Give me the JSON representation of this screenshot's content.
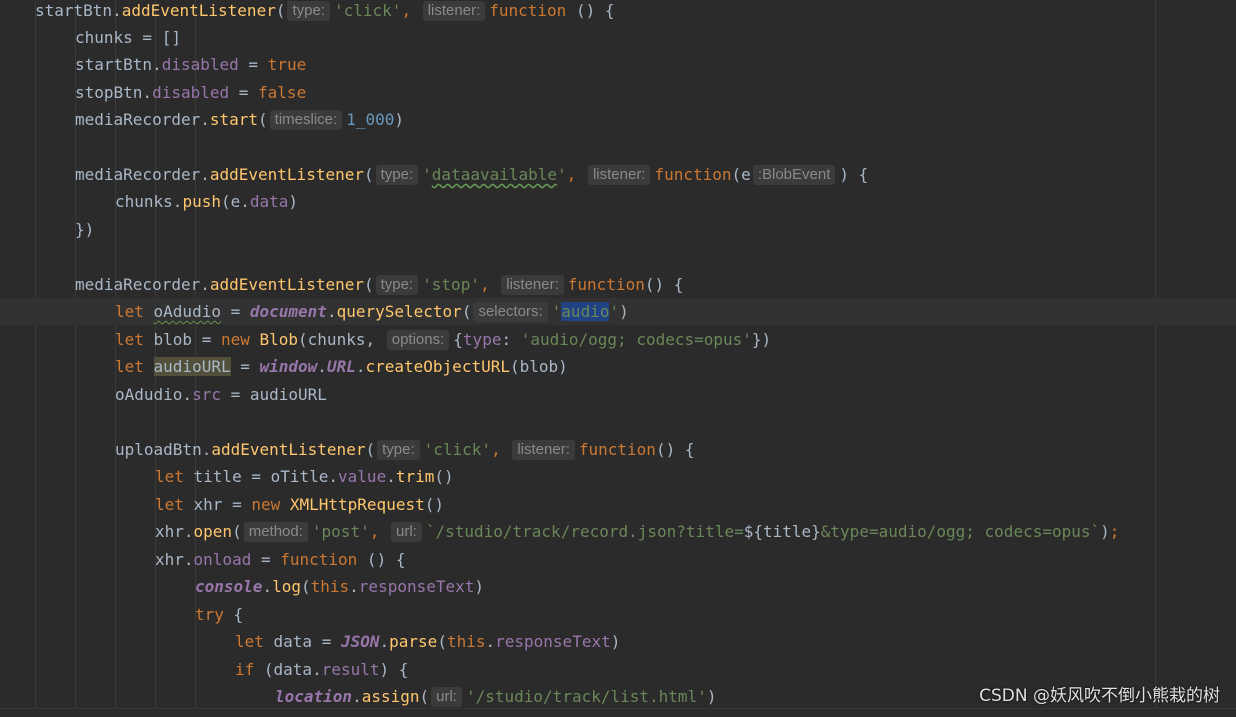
{
  "watermark": "CSDN @妖风吹不倒小熊栽的树",
  "code": {
    "l1": {
      "a": "startBtn.",
      "fn": "addEventListener",
      "b": "(",
      "h1": "type:",
      "s1": "'click'",
      "c": ",",
      "h2": "listener:",
      "kw": "function",
      "d": " () {"
    },
    "l2": {
      "a": "chunks = []"
    },
    "l3": {
      "a": "startBtn.",
      "p": "disabled",
      "b": " = ",
      "kw": "true"
    },
    "l4": {
      "a": "stopBtn.",
      "p": "disabled",
      "b": " = ",
      "kw": "false"
    },
    "l5": {
      "a": "mediaRecorder.",
      "fn": "start",
      "b": "(",
      "h": "timeslice:",
      "n": "1_000",
      "c": ")"
    },
    "l7": {
      "a": "mediaRecorder.",
      "fn": "addEventListener",
      "b": "(",
      "h1": "type:",
      "q1": "'",
      "s": "dataavailable",
      "q2": "'",
      "c": ",",
      "h2": "listener:",
      "kw": "function",
      "d": "(e",
      "h3": ":BlobEvent",
      "e": ") {"
    },
    "l8": {
      "a": "chunks.",
      "fn": "push",
      "b": "(e.",
      "p": "data",
      "c": ")"
    },
    "l9": {
      "a": "})"
    },
    "l11": {
      "a": "mediaRecorder.",
      "fn": "addEventListener",
      "b": "(",
      "h1": "type:",
      "s": "'stop'",
      "c": ",",
      "h2": "listener:",
      "kw": "function",
      "d": "() {"
    },
    "l12": {
      "kw": "let ",
      "v": "oAdudio",
      "b": " = ",
      "g": "document",
      "c": ".",
      "fn": "querySelector",
      "d": "(",
      "h": "selectors:",
      "q1": "'",
      "sel": "audio",
      "q2": "'",
      "e": ")"
    },
    "l13": {
      "kw": "let ",
      "a": "blob = ",
      "kw2": "new ",
      "fn": "Blob",
      "b": "(chunks,",
      "h": "options:",
      "c": "{",
      "p": "type",
      "d": ": ",
      "s": "'audio/ogg; codecs=opus'",
      "e": "})"
    },
    "l14": {
      "kw": "let ",
      "u": "audioURL",
      "b": " = ",
      "g1": "window",
      "c": ".",
      "g2": "URL",
      "d": ".",
      "fn": "createObjectURL",
      "e": "(blob)"
    },
    "l15": {
      "a": "oAdudio.",
      "p": "src",
      "b": " = audioURL"
    },
    "l17": {
      "a": "uploadBtn.",
      "fn": "addEventListener",
      "b": "(",
      "h1": "type:",
      "s": "'click'",
      "c": ",",
      "h2": "listener:",
      "kw": "function",
      "d": "() {"
    },
    "l18": {
      "kw": "let ",
      "a": "title = oTitle.",
      "p": "value",
      "b": ".",
      "fn": "trim",
      "c": "()"
    },
    "l19": {
      "kw": "let ",
      "a": "xhr = ",
      "kw2": "new ",
      "fn": "XMLHttpRequest",
      "b": "()"
    },
    "l20": {
      "a": "xhr.",
      "fn": "open",
      "b": "(",
      "h1": "method:",
      "s1": "'post'",
      "c": ",",
      "h2": "url:",
      "s2": "`/studio/track/record.json?title=",
      "x": "${title}",
      "s3": "&type=audio/ogg; codecs=opus`",
      "d": ")",
      "e": ";"
    },
    "l21": {
      "a": "xhr.",
      "p": "onload",
      "b": " = ",
      "kw": "function",
      "c": " () {"
    },
    "l22": {
      "g": "console",
      "a": ".",
      "fn": "log",
      "b": "(",
      "t": "this",
      "c": ".",
      "p": "responseText",
      "d": ")"
    },
    "l23": {
      "kw": "try",
      "a": " {"
    },
    "l24": {
      "kw": "let ",
      "a": "data = ",
      "g": "JSON",
      "b": ".",
      "fn": "parse",
      "c": "(",
      "t": "this",
      "d": ".",
      "p": "responseText",
      "e": ")"
    },
    "l25": {
      "kw": "if",
      "a": " (data.",
      "p": "result",
      "b": ") {"
    },
    "l26": {
      "g": "location",
      "a": ".",
      "fn": "assign",
      "b": "(",
      "h": "url:",
      "s": "'/studio/track/list.html'",
      "c": ")"
    }
  }
}
